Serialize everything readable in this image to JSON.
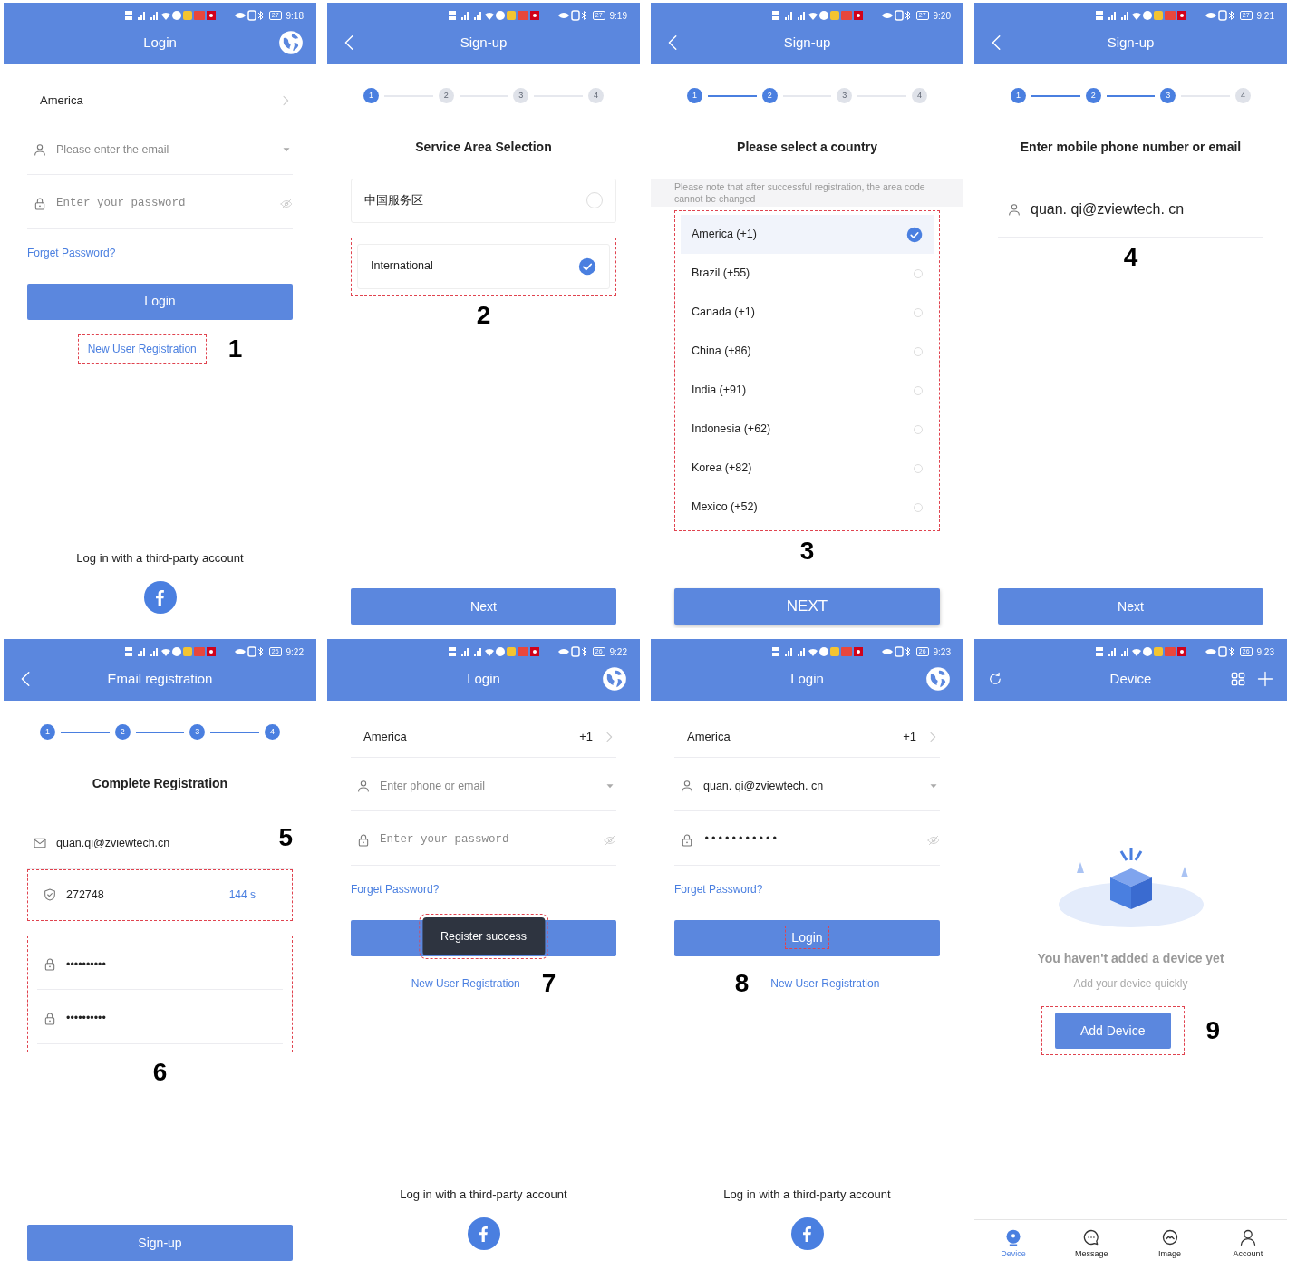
{
  "screens": [
    {
      "time": "9:18",
      "battery": "27",
      "header": {
        "title": "Login",
        "kind": "login"
      },
      "body": [
        {
          "kind": "select-row",
          "label": "America"
        },
        {
          "kind": "account-select",
          "placeholder": "Please enter the email"
        },
        {
          "kind": "password-field",
          "placeholder": "Enter your password"
        },
        {
          "kind": "link",
          "text": "Forget Password?"
        },
        {
          "kind": "button",
          "label": "Login"
        },
        {
          "kind": "text-link",
          "text": "New User Registration",
          "highlighted": true,
          "annotation": "1"
        },
        {
          "kind": "spacer"
        },
        {
          "kind": "third-party",
          "text": "Log in with a third-party account"
        }
      ]
    },
    {
      "time": "9:19",
      "battery": "27",
      "header": {
        "title": "Sign-up",
        "kind": "wizard"
      },
      "body": [
        {
          "kind": "stepper",
          "steps": [
            {
              "label": "1",
              "done": true
            },
            {
              "label": "2",
              "done": false
            },
            {
              "label": "3",
              "done": false
            },
            {
              "label": "4",
              "done": false
            }
          ]
        },
        {
          "kind": "heading",
          "text": "Service Area Selection"
        },
        {
          "kind": "option-card",
          "label": "中国服务区",
          "selected": false
        },
        {
          "kind": "option-card",
          "label": "International",
          "selected": true,
          "highlighted": true
        },
        {
          "kind": "annotation",
          "text": "2"
        },
        {
          "kind": "spacer"
        },
        {
          "kind": "button",
          "label": "Next"
        }
      ]
    },
    {
      "time": "9:20",
      "battery": "27",
      "header": {
        "title": "Sign-up",
        "kind": "wizard"
      },
      "body": [
        {
          "kind": "stepper",
          "steps": [
            {
              "label": "1",
              "done": true
            },
            {
              "label": "2",
              "done": true
            },
            {
              "label": "3",
              "done": false
            },
            {
              "label": "4",
              "done": false
            }
          ]
        },
        {
          "kind": "heading",
          "text": "Please select a country"
        },
        {
          "kind": "note",
          "text": "Please note that after successful registration, the area code cannot be changed"
        },
        {
          "kind": "option-list",
          "highlighted": true,
          "options": [
            {
              "label": "America (+1)",
              "selected": true
            },
            {
              "label": "Brazil (+55)",
              "selected": false
            },
            {
              "label": "Canada (+1)",
              "selected": false
            },
            {
              "label": "China (+86)",
              "selected": false
            },
            {
              "label": "India (+91)",
              "selected": false
            },
            {
              "label": "Indonesia (+62)",
              "selected": false
            },
            {
              "label": "Korea (+82)",
              "selected": false
            },
            {
              "label": "Mexico (+52)",
              "selected": false
            }
          ]
        },
        {
          "kind": "annotation",
          "text": "3"
        },
        {
          "kind": "spacer"
        },
        {
          "kind": "wide-button",
          "label": "NEXT"
        }
      ]
    },
    {
      "time": "9:21",
      "battery": "27",
      "header": {
        "title": "Sign-up",
        "kind": "wizard"
      },
      "body": [
        {
          "kind": "stepper",
          "steps": [
            {
              "label": "1",
              "done": true
            },
            {
              "label": "2",
              "done": true
            },
            {
              "label": "3",
              "done": true
            },
            {
              "label": "4",
              "done": false
            }
          ]
        },
        {
          "kind": "heading",
          "text": "Enter mobile phone number or email"
        },
        {
          "kind": "account-input",
          "value": "quan. qi@zviewtech. cn"
        },
        {
          "kind": "annotation",
          "text": "4"
        },
        {
          "kind": "spacer"
        },
        {
          "kind": "button",
          "label": "Next"
        }
      ]
    },
    {
      "time": "9:22",
      "battery": "26",
      "header": {
        "title": "Email registration",
        "kind": "wizard"
      },
      "body": [
        {
          "kind": "stepper",
          "steps": [
            {
              "label": "1",
              "done": true
            },
            {
              "label": "2",
              "done": true
            },
            {
              "label": "3",
              "done": true
            },
            {
              "label": "4",
              "done": true
            }
          ]
        },
        {
          "kind": "heading",
          "text": "Complete Registration"
        },
        {
          "kind": "email-display",
          "value": "quan.qi@zviewtech.cn",
          "annotation": "5"
        },
        {
          "kind": "code-row",
          "value": "272748",
          "countdown": "144 s",
          "highlighted": true
        },
        {
          "kind": "group",
          "highlighted": true,
          "children": [
            {
              "kind": "password-input",
              "value": "••••••••••"
            },
            {
              "kind": "password-input",
              "value": "••••••••••"
            }
          ]
        },
        {
          "kind": "annotation",
          "text": "6"
        },
        {
          "kind": "spacer"
        },
        {
          "kind": "button",
          "label": "Sign-up"
        }
      ]
    },
    {
      "time": "9:22",
      "battery": "26",
      "header": {
        "title": "Login",
        "kind": "login"
      },
      "body": [
        {
          "kind": "select-row",
          "label": "America",
          "value": "+1"
        },
        {
          "kind": "account-select",
          "placeholder": "Enter phone or email"
        },
        {
          "kind": "password-field",
          "placeholder": "Enter your password"
        },
        {
          "kind": "link",
          "text": "Forget Password?"
        },
        {
          "kind": "button",
          "toast": "Register success",
          "toast_highlighted": true
        },
        {
          "kind": "text-link",
          "text": "New User Registration",
          "annotation": "7"
        },
        {
          "kind": "spacer"
        },
        {
          "kind": "third-party",
          "text": "Log in with a third-party account"
        }
      ]
    },
    {
      "time": "9:23",
      "battery": "26",
      "header": {
        "title": "Login",
        "kind": "login"
      },
      "body": [
        {
          "kind": "select-row",
          "label": "America",
          "value": "+1"
        },
        {
          "kind": "account-select",
          "value": "quan. qi@zviewtech. cn"
        },
        {
          "kind": "password-field",
          "value": "•••••••••••"
        },
        {
          "kind": "link",
          "text": "Forget Password?"
        },
        {
          "kind": "button",
          "label": "Login",
          "label_highlighted": true
        },
        {
          "kind": "text-link",
          "text": "New User Registration",
          "annotation_before": "8"
        },
        {
          "kind": "spacer"
        },
        {
          "kind": "third-party",
          "text": "Log in with a third-party account"
        }
      ]
    },
    {
      "time": "9:23",
      "battery": "26",
      "header": {
        "title": "Device",
        "kind": "home"
      },
      "body": [
        {
          "kind": "empty-state",
          "title": "You haven't added a device yet",
          "subtitle": "Add your device quickly"
        },
        {
          "kind": "compact-button",
          "label": "Add Device",
          "highlighted": true,
          "annotation": "9"
        },
        {
          "kind": "spacer"
        },
        {
          "kind": "tabbar",
          "items": [
            {
              "label": "Device",
              "selected": true
            },
            {
              "label": "Message",
              "selected": false
            },
            {
              "label": "Image",
              "selected": false
            },
            {
              "label": "Account",
              "selected": false
            }
          ]
        }
      ]
    }
  ]
}
